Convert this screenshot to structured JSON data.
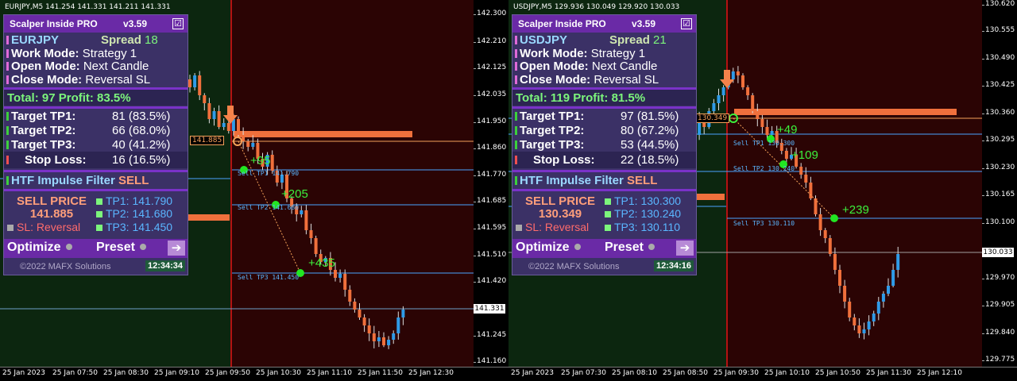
{
  "colors": {
    "bull": "#2f9be8",
    "bear": "#f0703c",
    "buy_zone": "#0c260f",
    "sell_zone": "#2b0404",
    "signal_line": "#b31212",
    "tp_line": "#4aa3ff",
    "level_bar": "#f0703c",
    "panel_bg": "#3b3166",
    "panel_header": "#6a2aa6",
    "points": "#3cf03c",
    "entry_arrow": "#f5824a"
  },
  "charts": [
    {
      "symbol_line": "EURJPY,M5  141.254 141.331 141.211 141.331",
      "price_ticks": [
        "142.300",
        "142.210",
        "142.125",
        "142.035",
        "141.950",
        "141.860",
        "141.770",
        "141.685",
        "141.595",
        "141.510",
        "141.420",
        "141.331",
        "141.245",
        "141.160"
      ],
      "current_price": "141.331",
      "time_labels": [
        "25 Jan 2023",
        "25 Jan 07:50",
        "25 Jan 08:30",
        "25 Jan 09:10",
        "25 Jan 09:50",
        "25 Jan 10:30",
        "25 Jan 11:10",
        "25 Jan 11:50",
        "25 Jan 12:30"
      ],
      "entry_label": "141.885",
      "tp_labels": [
        "Sell TP1 141.790",
        "Sell TP2 141.680",
        "Sell TP3 141.450"
      ],
      "points": [
        "+95",
        "+205",
        "+435"
      ],
      "panel": {
        "title": "Scalper Inside PRO",
        "version": "v3.59",
        "check": "☑",
        "symbol": "EURJPY",
        "spread_label": "Spread",
        "spread_value": "18",
        "work_mode_label": "Work Mode:",
        "work_mode": "Strategy 1",
        "open_mode_label": "Open Mode:",
        "open_mode": "Next Candle",
        "close_mode_label": "Close Mode:",
        "close_mode": "Reversal SL",
        "total": "Total: 97  Profit: 83.5%",
        "tp1_label": "Target TP1:",
        "tp1": "81 (83.5%)",
        "tp2_label": "Target TP2:",
        "tp2": "66 (68.0%)",
        "tp3_label": "Target TP3:",
        "tp3": "40 (41.2%)",
        "sl_label": "Stop Loss:",
        "sl": "16 (16.5%)",
        "htf_label": "HTF Impulse Filter",
        "htf_value": "SELL",
        "sell_price_label": "SELL PRICE",
        "sell_price": "141.885",
        "sl_reversal": "SL: Reversal",
        "tp1_price": "TP1: 141.790",
        "tp2_price": "TP2: 141.680",
        "tp3_price": "TP3: 141.450",
        "optimize": "Optimize",
        "preset": "Preset",
        "arrow": "➔",
        "copyright": "©2022 MAFX Solutions",
        "clock": "12:34:34"
      }
    },
    {
      "symbol_line": "USDJPY,M5  129.936 130.049 129.920 130.033",
      "price_ticks": [
        "130.620",
        "130.555",
        "130.490",
        "130.425",
        "130.360",
        "130.295",
        "130.230",
        "130.165",
        "130.100",
        "130.033",
        "129.970",
        "129.905",
        "129.840",
        "129.775"
      ],
      "current_price": "130.033",
      "time_labels": [
        "25 Jan 2023",
        "25 Jan 07:30",
        "25 Jan 08:10",
        "25 Jan 08:50",
        "25 Jan 09:30",
        "25 Jan 10:10",
        "25 Jan 10:50",
        "25 Jan 11:30",
        "25 Jan 12:10"
      ],
      "entry_label": "130.349",
      "tp_labels": [
        "Sell TP1 130.300",
        "Sell TP2 130.240",
        "Sell TP3 130.110"
      ],
      "points": [
        "+49",
        "+109",
        "+239"
      ],
      "panel": {
        "title": "Scalper Inside PRO",
        "version": "v3.59",
        "check": "☑",
        "symbol": "USDJPY",
        "spread_label": "Spread",
        "spread_value": "21",
        "work_mode_label": "Work Mode:",
        "work_mode": "Strategy 1",
        "open_mode_label": "Open Mode:",
        "open_mode": "Next Candle",
        "close_mode_label": "Close Mode:",
        "close_mode": "Reversal SL",
        "total": "Total: 119  Profit: 81.5%",
        "tp1_label": "Target TP1:",
        "tp1": "97 (81.5%)",
        "tp2_label": "Target TP2:",
        "tp2": "80 (67.2%)",
        "tp3_label": "Target TP3:",
        "tp3": "53 (44.5%)",
        "sl_label": "Stop Loss:",
        "sl": "22 (18.5%)",
        "htf_label": "HTF Impulse Filter",
        "htf_value": "SELL",
        "sell_price_label": "SELL PRICE",
        "sell_price": "130.349",
        "sl_reversal": "SL: Reversal",
        "tp1_price": "TP1: 130.300",
        "tp2_price": "TP2: 130.240",
        "tp3_price": "TP3: 130.110",
        "optimize": "Optimize",
        "preset": "Preset",
        "arrow": "➔",
        "copyright": "©2022 MAFX Solutions",
        "clock": "12:34:16"
      }
    }
  ]
}
